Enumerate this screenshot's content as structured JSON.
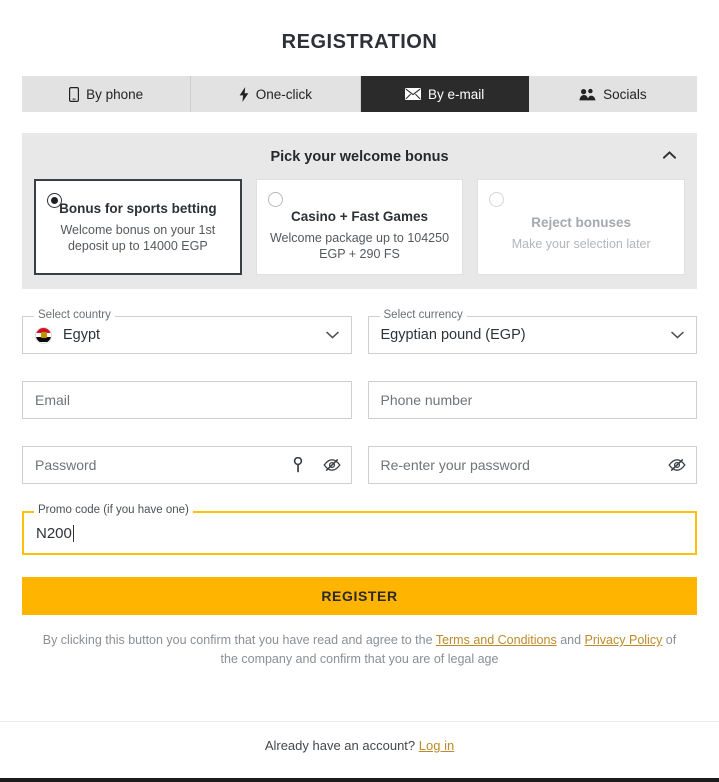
{
  "page": {
    "title": "REGISTRATION"
  },
  "tabs": [
    {
      "label": "By phone",
      "icon": "phone-icon",
      "active": false
    },
    {
      "label": "One-click",
      "icon": "bolt-icon",
      "active": false
    },
    {
      "label": "By e-mail",
      "icon": "envelope-icon",
      "active": true
    },
    {
      "label": "Socials",
      "icon": "people-icon",
      "active": false
    }
  ],
  "bonus": {
    "header": "Pick your welcome bonus",
    "collapse_icon": "chevron-up-icon",
    "cards": [
      {
        "title": "Bonus for sports betting",
        "subtitle": "Welcome bonus on your 1st deposit up to 14000 EGP",
        "selected": true,
        "muted": false
      },
      {
        "title": "Casino + Fast Games",
        "subtitle": "Welcome package up to 104250 EGP + 290 FS",
        "selected": false,
        "muted": false
      },
      {
        "title": "Reject bonuses",
        "subtitle": "Make your selection later",
        "selected": false,
        "muted": true
      }
    ]
  },
  "form": {
    "country": {
      "label": "Select country",
      "value": "Egypt",
      "flag": "egypt-flag-icon",
      "chevron": "chevron-down-icon"
    },
    "currency": {
      "label": "Select currency",
      "value": "Egyptian pound (EGP)",
      "chevron": "chevron-down-icon"
    },
    "email": {
      "placeholder": "Email",
      "value": ""
    },
    "phone": {
      "placeholder": "Phone number",
      "value": ""
    },
    "password": {
      "placeholder": "Password",
      "value": "",
      "key_icon": "key-icon",
      "reveal_icon": "eye-off-icon"
    },
    "password_repeat": {
      "placeholder": "Re-enter your password",
      "value": "",
      "reveal_icon": "eye-off-icon"
    },
    "promo": {
      "label": "Promo code (if you have one)",
      "value": "N200",
      "focused": true
    }
  },
  "actions": {
    "register_label": "REGISTER"
  },
  "legal": {
    "text_part1": "By clicking this button you confirm that you have read and agree to the ",
    "terms_link": "Terms and Conditions",
    "text_part2": " and ",
    "privacy_link": "Privacy Policy",
    "text_part3": " of the company and confirm that you are of legal age"
  },
  "footer": {
    "prompt": "Already have an account?",
    "login_link": "Log in"
  },
  "colors": {
    "accent": "#ffb400",
    "promo_border": "#ffc107",
    "link": "#bd8b2a",
    "active_tab_bg": "#2b2b2b",
    "tab_bg": "#e2e2e2",
    "bonus_bg": "#e8e8e8"
  }
}
